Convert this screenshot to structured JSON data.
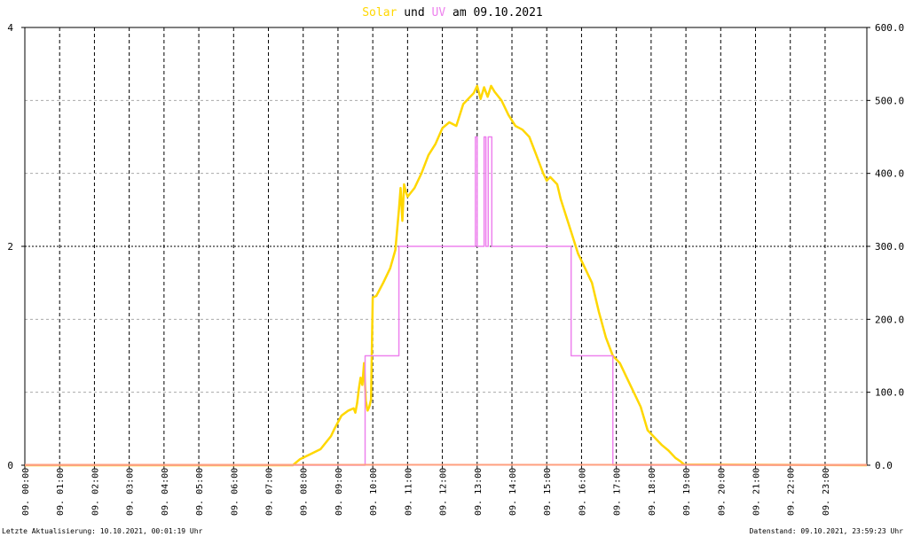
{
  "title": {
    "part1": "Solar",
    "part2": " und ",
    "part3": "UV",
    "part4": " am 09.10.2021",
    "solar_color": "#ffd700",
    "uv_color": "#ee82ee"
  },
  "footer": {
    "left": "Letzte Aktualisierung: 10.10.2021, 00:01:19 Uhr",
    "right": "Datenstand: 09.10.2021, 23:59:23 Uhr"
  },
  "chart_data": {
    "type": "line",
    "x_unit": "hour of day",
    "xlim": [
      0,
      24.2
    ],
    "x_ticks": [
      0,
      1,
      2,
      3,
      4,
      5,
      6,
      7,
      8,
      9,
      10,
      11,
      12,
      13,
      14,
      15,
      16,
      17,
      18,
      19,
      20,
      21,
      22,
      23
    ],
    "x_tick_labels": [
      "09. 00:00",
      "09. 01:00",
      "09. 02:00",
      "09. 03:00",
      "09. 04:00",
      "09. 05:00",
      "09. 06:00",
      "09. 07:00",
      "09. 08:00",
      "09. 09:00",
      "09. 10:00",
      "09. 11:00",
      "09. 12:00",
      "09. 13:00",
      "09. 14:00",
      "09. 15:00",
      "09. 16:00",
      "09. 17:00",
      "09. 18:00",
      "09. 19:00",
      "09. 20:00",
      "09. 21:00",
      "09. 22:00",
      "09. 23:00"
    ],
    "y_left": {
      "lim": [
        0,
        4
      ],
      "ticks": [
        0,
        2,
        4
      ],
      "tick_labels": [
        "0",
        "2",
        "4"
      ]
    },
    "y_right": {
      "lim": [
        0,
        600
      ],
      "ticks": [
        0,
        100,
        200,
        300,
        400,
        500,
        600
      ],
      "tick_labels": [
        "0.0",
        "100.0",
        "200.0",
        "300.0",
        "400.0",
        "500.0",
        "600.0"
      ]
    },
    "grid": true,
    "series": [
      {
        "name": "Solar",
        "axis": "right",
        "color": "#ffd700",
        "x": [
          0,
          7.7,
          7.9,
          8.2,
          8.5,
          8.8,
          8.9,
          9.1,
          9.3,
          9.45,
          9.5,
          9.55,
          9.6,
          9.65,
          9.7,
          9.75,
          9.8,
          9.85,
          9.9,
          9.95,
          10.0,
          10.1,
          10.3,
          10.5,
          10.65,
          10.75,
          10.8,
          10.85,
          10.9,
          10.95,
          11.0,
          11.2,
          11.4,
          11.6,
          11.8,
          12.0,
          12.2,
          12.4,
          12.6,
          12.8,
          12.9,
          13.0,
          13.1,
          13.2,
          13.3,
          13.4,
          13.5,
          13.7,
          13.9,
          14.1,
          14.3,
          14.5,
          14.7,
          14.9,
          15.0,
          15.1,
          15.3,
          15.4,
          15.5,
          15.7,
          15.9,
          16.1,
          16.3,
          16.5,
          16.7,
          16.9,
          17.1,
          17.3,
          17.5,
          17.7,
          17.9,
          18.1,
          18.3,
          18.5,
          18.7,
          18.85,
          18.95,
          24.2
        ],
        "y": [
          0,
          0,
          8,
          15,
          22,
          40,
          50,
          68,
          75,
          78,
          72,
          85,
          105,
          120,
          110,
          140,
          88,
          75,
          80,
          90,
          230,
          232,
          250,
          270,
          295,
          350,
          380,
          335,
          385,
          375,
          368,
          380,
          400,
          425,
          440,
          462,
          470,
          465,
          495,
          505,
          510,
          520,
          502,
          518,
          505,
          520,
          512,
          500,
          480,
          465,
          460,
          450,
          425,
          400,
          390,
          395,
          385,
          365,
          350,
          320,
          290,
          270,
          250,
          210,
          175,
          150,
          140,
          120,
          100,
          80,
          48,
          38,
          28,
          20,
          10,
          5,
          1,
          0
        ]
      },
      {
        "name": "UV",
        "axis": "left",
        "color": "#ee82ee",
        "x": [
          0,
          9.78,
          9.78,
          9.85,
          9.85,
          10.75,
          10.75,
          10.85,
          10.85,
          12.95,
          12.95,
          13.0,
          13.0,
          13.2,
          13.2,
          13.25,
          13.25,
          13.32,
          13.32,
          13.42,
          13.42,
          15.7,
          15.7,
          16.9,
          16.9,
          24.2
        ],
        "y": [
          0,
          0,
          1,
          1,
          1,
          1,
          2,
          2,
          2,
          2,
          3,
          3,
          2,
          2,
          3,
          3,
          2,
          2,
          3,
          3,
          2,
          2,
          1,
          1,
          0,
          0
        ]
      }
    ]
  }
}
